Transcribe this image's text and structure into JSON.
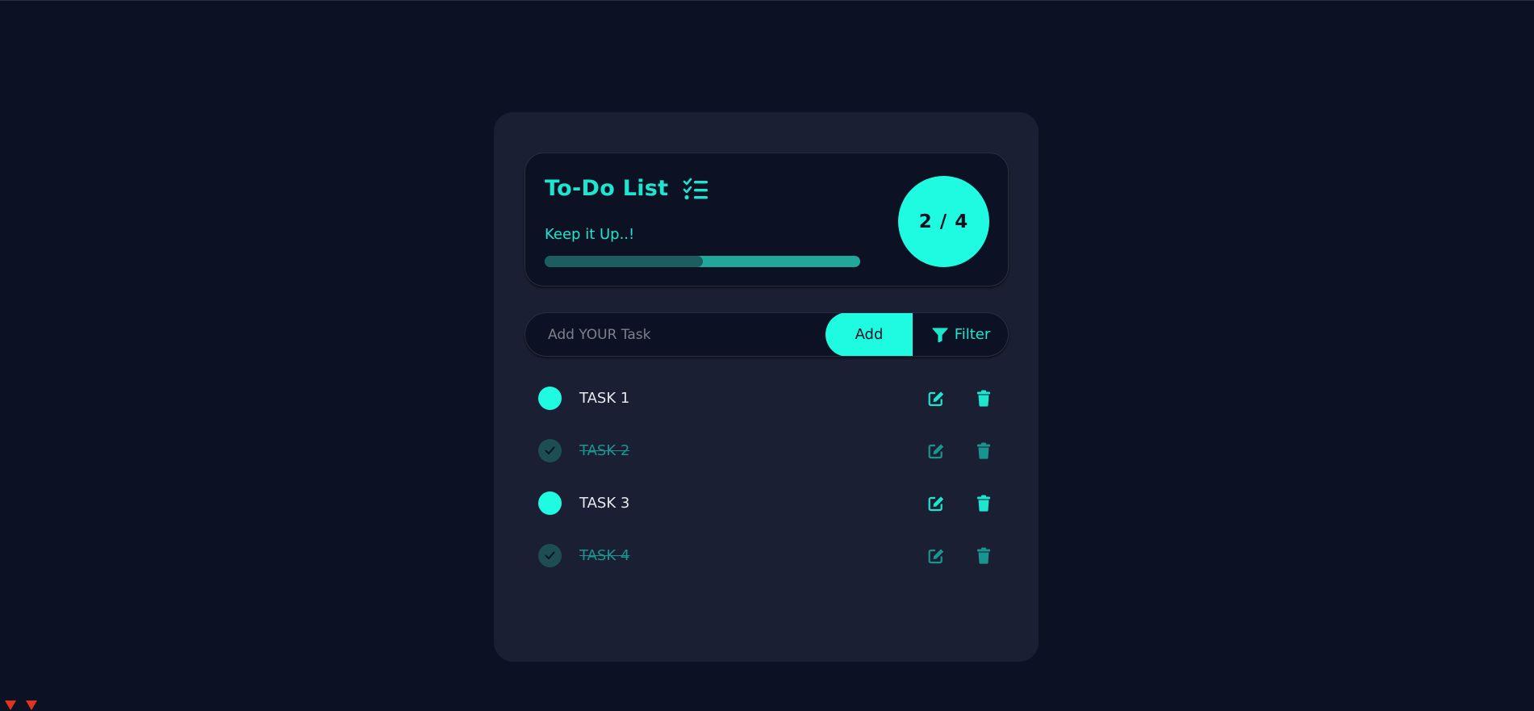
{
  "header": {
    "title": "To-Do List",
    "title_icon": "list-check-icon",
    "subtitle": "Keep it Up..!",
    "progress_percent": 50,
    "counter": "2 / 4"
  },
  "input_bar": {
    "placeholder": "Add YOUR Task",
    "value": "",
    "add_label": "Add",
    "filter_label": "Filter",
    "filter_icon": "filter-icon"
  },
  "tasks": [
    {
      "label": "TASK 1",
      "completed": false
    },
    {
      "label": "TASK 2",
      "completed": true
    },
    {
      "label": "TASK 3",
      "completed": false
    },
    {
      "label": "TASK 4",
      "completed": true
    }
  ],
  "colors": {
    "background": "#0c1223",
    "card": "#1a1f33",
    "accent": "#1efbe1",
    "accent_text": "#1ee5cf",
    "completed": "#1a958e"
  }
}
